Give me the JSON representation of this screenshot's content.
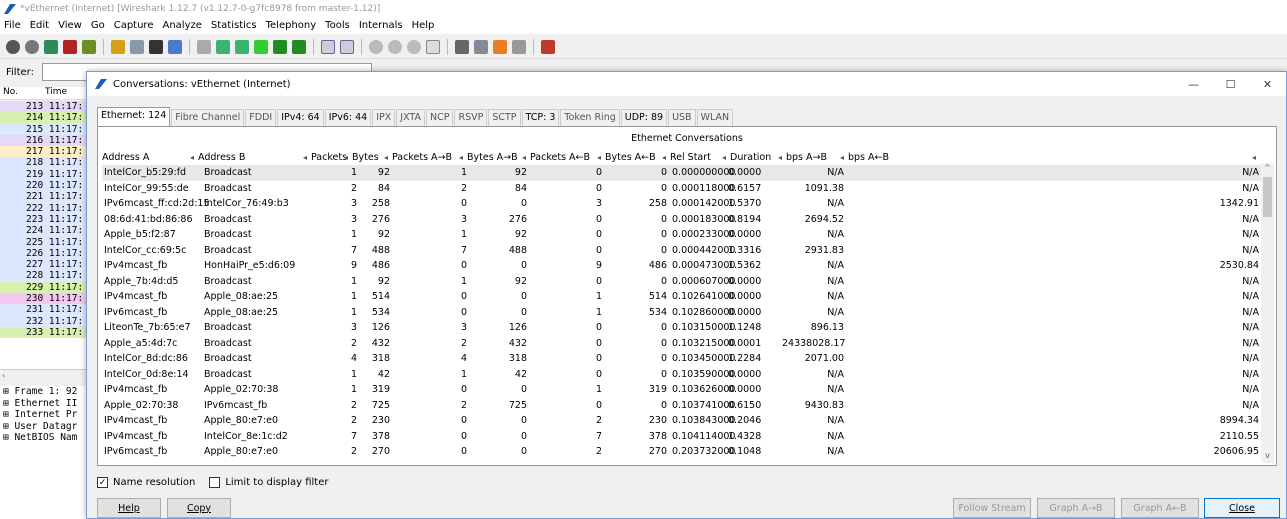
{
  "main": {
    "title": "*vEthernet (Internet)   [Wireshark 1.12.7  (v1.12.7-0-g7fc8978 from master-1.12)]",
    "menu": [
      "File",
      "Edit",
      "View",
      "Go",
      "Capture",
      "Analyze",
      "Statistics",
      "Telephony",
      "Tools",
      "Internals",
      "Help"
    ],
    "filter_label": "Filter:",
    "packet_columns": [
      "No.",
      "Time"
    ],
    "packets": [
      "213 11:17:",
      "214 11:17:",
      "215 11:17:",
      "216 11:17:",
      "217 11:17:",
      "218 11:17:",
      "219 11:17:",
      "220 11:17:",
      "221 11:17:",
      "222 11:17:",
      "223 11:17:",
      "224 11:17:",
      "225 11:17:",
      "226 11:17:",
      "227 11:17:",
      "228 11:17:",
      "229 11:17:",
      "230 11:17:",
      "231 11:17:",
      "232 11:17:",
      "233 11:17:"
    ],
    "packet_colors": [
      "#e4d9f7",
      "#d8f0b0",
      "#dde8ff",
      "#e4d9f7",
      "#fdeec8",
      "#dde8ff",
      "#dde8ff",
      "#dde8ff",
      "#dde8ff",
      "#dde8ff",
      "#dde8ff",
      "#dde8ff",
      "#dde8ff",
      "#dde8ff",
      "#dde8ff",
      "#dde8ff",
      "#d8f0b0",
      "#f4c8f0",
      "#dde8ff",
      "#dde8ff",
      "#d8f0b0"
    ],
    "tree": [
      "⊞ Frame 1: 92",
      "⊞ Ethernet II",
      "⊞ Internet Pr",
      "⊞ User Datagr",
      "⊞ NetBIOS Nam"
    ]
  },
  "dialog": {
    "title": "Conversations: vEthernet (Internet)",
    "tabs": [
      "Ethernet: 124",
      "Fibre Channel",
      "FDDI",
      "IPv4: 64",
      "IPv6: 44",
      "IPX",
      "JXTA",
      "NCP",
      "RSVP",
      "SCTP",
      "TCP: 3",
      "Token Ring",
      "UDP: 89",
      "USB",
      "WLAN"
    ],
    "tabs_populated": [
      true,
      false,
      false,
      true,
      true,
      false,
      false,
      false,
      false,
      false,
      true,
      false,
      true,
      false,
      false
    ],
    "panel_title": "Ethernet Conversations",
    "columns": [
      "Address A",
      "Address B",
      "Packets",
      "Bytes",
      "Packets A→B",
      "Bytes A→B",
      "Packets A←B",
      "Bytes A←B",
      "Rel Start",
      "Duration",
      "bps A→B",
      "bps A←B"
    ],
    "rows": [
      [
        "IntelCor_b5:29:fd",
        "Broadcast",
        "1",
        "92",
        "1",
        "92",
        "0",
        "0",
        "0.000000000",
        "0.0000",
        "N/A",
        "N/A"
      ],
      [
        "IntelCor_99:55:de",
        "Broadcast",
        "2",
        "84",
        "2",
        "84",
        "0",
        "0",
        "0.000118000",
        "0.6157",
        "1091.38",
        "N/A"
      ],
      [
        "IPv6mcast_ff:cd:2d:15",
        "IntelCor_76:49:b3",
        "3",
        "258",
        "0",
        "0",
        "3",
        "258",
        "0.000142000",
        "1.5370",
        "N/A",
        "1342.91"
      ],
      [
        "08:6d:41:bd:86:86",
        "Broadcast",
        "3",
        "276",
        "3",
        "276",
        "0",
        "0",
        "0.000183000",
        "0.8194",
        "2694.52",
        "N/A"
      ],
      [
        "Apple_b5:f2:87",
        "Broadcast",
        "1",
        "92",
        "1",
        "92",
        "0",
        "0",
        "0.000233000",
        "0.0000",
        "N/A",
        "N/A"
      ],
      [
        "IntelCor_cc:69:5c",
        "Broadcast",
        "7",
        "488",
        "7",
        "488",
        "0",
        "0",
        "0.000442000",
        "1.3316",
        "2931.83",
        "N/A"
      ],
      [
        "IPv4mcast_fb",
        "HonHaiPr_e5:d6:09",
        "9",
        "486",
        "0",
        "0",
        "9",
        "486",
        "0.000473000",
        "1.5362",
        "N/A",
        "2530.84"
      ],
      [
        "Apple_7b:4d:d5",
        "Broadcast",
        "1",
        "92",
        "1",
        "92",
        "0",
        "0",
        "0.000607000",
        "0.0000",
        "N/A",
        "N/A"
      ],
      [
        "IPv4mcast_fb",
        "Apple_08:ae:25",
        "1",
        "514",
        "0",
        "0",
        "1",
        "514",
        "0.102641000",
        "0.0000",
        "N/A",
        "N/A"
      ],
      [
        "IPv6mcast_fb",
        "Apple_08:ae:25",
        "1",
        "534",
        "0",
        "0",
        "1",
        "534",
        "0.102860000",
        "0.0000",
        "N/A",
        "N/A"
      ],
      [
        "LiteonTe_7b:65:e7",
        "Broadcast",
        "3",
        "126",
        "3",
        "126",
        "0",
        "0",
        "0.103150000",
        "1.1248",
        "896.13",
        "N/A"
      ],
      [
        "Apple_a5:4d:7c",
        "Broadcast",
        "2",
        "432",
        "2",
        "432",
        "0",
        "0",
        "0.103215000",
        "0.0001",
        "24338028.17",
        "N/A"
      ],
      [
        "IntelCor_8d:dc:86",
        "Broadcast",
        "4",
        "318",
        "4",
        "318",
        "0",
        "0",
        "0.103450000",
        "1.2284",
        "2071.00",
        "N/A"
      ],
      [
        "IntelCor_0d:8e:14",
        "Broadcast",
        "1",
        "42",
        "1",
        "42",
        "0",
        "0",
        "0.103590000",
        "0.0000",
        "N/A",
        "N/A"
      ],
      [
        "IPv4mcast_fb",
        "Apple_02:70:38",
        "1",
        "319",
        "0",
        "0",
        "1",
        "319",
        "0.103626000",
        "0.0000",
        "N/A",
        "N/A"
      ],
      [
        "Apple_02:70:38",
        "IPv6mcast_fb",
        "2",
        "725",
        "2",
        "725",
        "0",
        "0",
        "0.103741000",
        "0.6150",
        "9430.83",
        "N/A"
      ],
      [
        "IPv4mcast_fb",
        "Apple_80:e7:e0",
        "2",
        "230",
        "0",
        "0",
        "2",
        "230",
        "0.103843000",
        "0.2046",
        "N/A",
        "8994.34"
      ],
      [
        "IPv4mcast_fb",
        "IntelCor_8e:1c:d2",
        "7",
        "378",
        "0",
        "0",
        "7",
        "378",
        "0.104114000",
        "1.4328",
        "N/A",
        "2110.55"
      ],
      [
        "IPv6mcast_fb",
        "Apple_80:e7:e0",
        "2",
        "270",
        "0",
        "0",
        "2",
        "270",
        "0.203732000",
        "0.1048",
        "N/A",
        "20606.95"
      ]
    ],
    "name_resolution_label": "Name resolution",
    "limit_filter_label": "Limit to display filter",
    "buttons": {
      "help": "Help",
      "copy": "Copy",
      "follow_stream": "Follow Stream",
      "graph_ab": "Graph A→B",
      "graph_ba": "Graph A←B",
      "close": "Close"
    }
  }
}
